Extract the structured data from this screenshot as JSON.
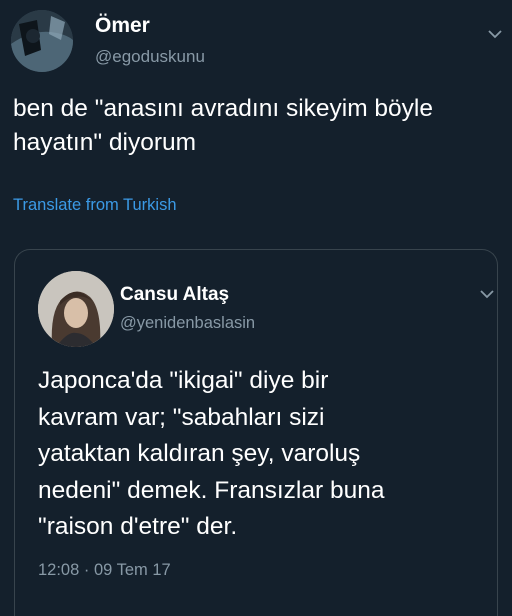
{
  "tweet": {
    "author": {
      "name": "Ömer",
      "handle": "@egoduskunu"
    },
    "text": "ben de \"anasını avradını sikeyim böyle\nhayatın\" diyorum",
    "translate_label": "Translate from Turkish"
  },
  "quoted_tweet": {
    "author": {
      "name": "Cansu Altaş",
      "handle": "@yenidenbaslasin"
    },
    "text": "Japonca'da \"ikigai\" diye bir\nkavram var; \"sabahları sizi\nyataktan kaldıran şey, varoluş\nnedeni\" demek. Fransızlar buna\n\"raison d'etre\" der.",
    "timestamp": "12:08 · 09 Tem 17"
  },
  "colors": {
    "background": "#14202c",
    "secondary_text": "#8899a6",
    "link": "#3b9ae6",
    "border": "#38444d"
  },
  "icons": {
    "menu_chevron": "chevron-down-icon"
  }
}
